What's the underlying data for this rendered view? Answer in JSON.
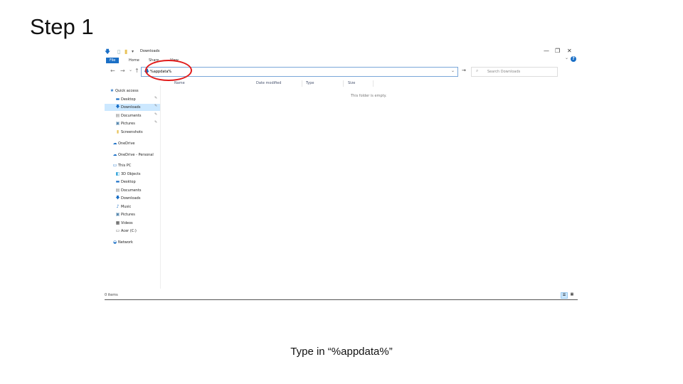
{
  "slide": {
    "title": "Step 1",
    "caption": "Type in “%appdata%”"
  },
  "window": {
    "title": "Downloads",
    "controls": {
      "minimize": "—",
      "maximize": "❐",
      "close": "✕"
    }
  },
  "ribbon": {
    "tabs": [
      "File",
      "Home",
      "Share",
      "View"
    ],
    "help": "?"
  },
  "address_bar": {
    "value": "%appdata%",
    "dropdown": "⌄",
    "go": "→"
  },
  "search": {
    "placeholder": "Search Downloads"
  },
  "columns": [
    "Name",
    "Date modified",
    "Type",
    "Size"
  ],
  "empty_message": "This folder is empty.",
  "nav_pane": {
    "quick_access": "Quick access",
    "quick_items": [
      "Desktop",
      "Downloads",
      "Documents",
      "Pictures",
      "Screenshots"
    ],
    "onedrive": "OneDrive",
    "onedrive_personal": "OneDrive - Personal",
    "this_pc": "This PC",
    "pc_items": [
      "3D Objects",
      "Desktop",
      "Documents",
      "Downloads",
      "Music",
      "Pictures",
      "Videos",
      "Acer (C:)"
    ],
    "network": "Network"
  },
  "status_bar": {
    "items_count": "0 items"
  },
  "colors": {
    "accent": "#1a6fc6",
    "selected": "#cce8ff",
    "annotation": "#e11b1b"
  }
}
